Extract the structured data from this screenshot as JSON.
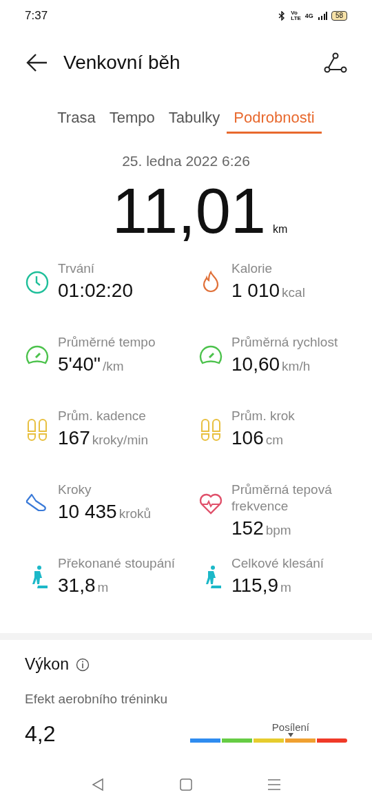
{
  "status_bar": {
    "time": "7:37",
    "volte_top": "Vo",
    "volte_bottom": "LTE",
    "network": "4G",
    "battery": "58"
  },
  "header": {
    "title": "Venkovní běh"
  },
  "tabs": [
    {
      "label": "Trasa",
      "selected": false
    },
    {
      "label": "Tempo",
      "selected": false
    },
    {
      "label": "Tabulky",
      "selected": false
    },
    {
      "label": "Podrobnosti",
      "selected": true
    }
  ],
  "date": "25. ledna 2022 6:26",
  "distance": {
    "value": "11,01",
    "unit": "km"
  },
  "stats": [
    {
      "kind": "clock",
      "label": "Trvání",
      "value": "01:02:20"
    },
    {
      "kind": "flame",
      "label": "Kalorie",
      "value": "1 010",
      "unit": "kcal"
    },
    {
      "kind": "gauge",
      "label": "Průměrné tempo",
      "value": "5'40\"",
      "unit": "/km"
    },
    {
      "kind": "gauge",
      "label": "Průměrná rychlost",
      "value": "10,60",
      "unit": "km/h"
    },
    {
      "kind": "footprints",
      "label": "Prům. kadence",
      "value": "167",
      "unit": "kroky/min"
    },
    {
      "kind": "footprints",
      "label": "Prům. krok",
      "value": "106",
      "unit": "cm"
    },
    {
      "kind": "shoe",
      "label": "Kroky",
      "value": "10 435",
      "unit": "kroků"
    },
    {
      "kind": "heart",
      "label": "Průměrná tepová frekvence",
      "value": "152",
      "unit": "bpm"
    },
    {
      "kind": "hiker",
      "label": "Překonané stoupání",
      "value": "31,8",
      "unit": "m"
    },
    {
      "kind": "hiker",
      "label": "Celkové klesání",
      "value": "115,9",
      "unit": "m"
    }
  ],
  "performance": {
    "title": "Výkon",
    "metric_label": "Efekt aerobního tréninku",
    "metric_value": "4,2",
    "marker_label": "Posílení",
    "segments": [
      {
        "color": "#2f8cf0"
      },
      {
        "color": "#66cc44"
      },
      {
        "color": "#e6cc2e"
      },
      {
        "color": "#f0a030"
      },
      {
        "color": "#f03a28"
      }
    ]
  }
}
